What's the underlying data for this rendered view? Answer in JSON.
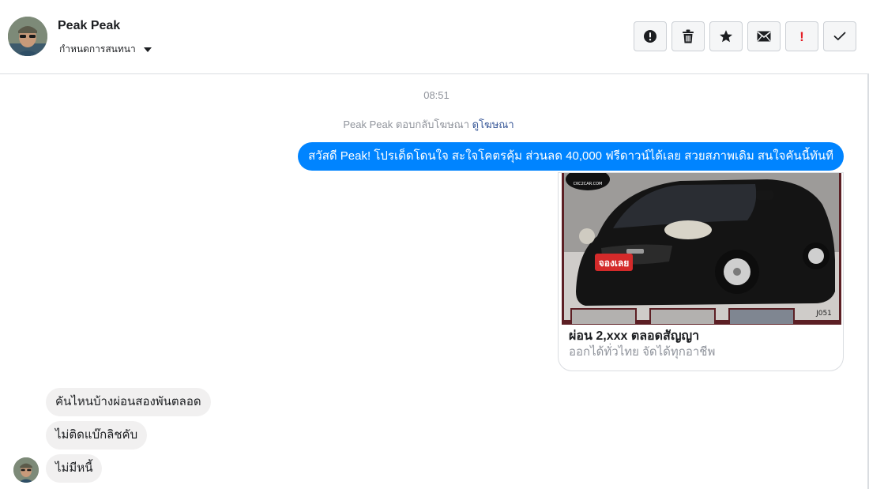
{
  "header": {
    "name": "Peak Peak",
    "subtitle": "กำหนดการสนทนา",
    "avatar_icon": "user-photo-icon"
  },
  "actions": [
    {
      "name": "report-button",
      "icon": "exclamation-circle-icon"
    },
    {
      "name": "delete-button",
      "icon": "trash-icon"
    },
    {
      "name": "star-button",
      "icon": "star-icon"
    },
    {
      "name": "mark-unread-button",
      "icon": "envelope-icon"
    },
    {
      "name": "important-button",
      "icon": "red-exclamation-icon",
      "label": "!"
    },
    {
      "name": "done-button",
      "icon": "check-icon"
    }
  ],
  "conversation": {
    "time": "08:51",
    "reply_note": "Peak Peak ตอบกลับโฆษณา",
    "reply_link": "ดูโฆษณา",
    "outgoing_message": "สวัสดี Peak! โปรเด็ดโดนใจ สะใจโคตรคุ้ม ส่วนลด 40,000 ฟรีดาวน์ได้เลย สวยสภาพเดิม สนใจคันนี้ทันที",
    "ad_card": {
      "title": "ผ่อน 2,xxx ตลอดสัญญา",
      "subtitle": "ออกได้ทั่วไทย จัดได้ทุกอาชีพ",
      "image_label": "จองเลย",
      "image_code": "J051",
      "image_logo": "CKC2CAR.COM"
    },
    "incoming_messages": [
      "คันไหนบ้างผ่อนสองพันตลอด",
      "ไม่ติดแบ๊กลิชคับ",
      "ไม่มีหนี้"
    ]
  },
  "colors": {
    "accent_blue": "#0084ff",
    "incoming_bubble": "#f1f0f0",
    "important_red": "#e41e26"
  }
}
